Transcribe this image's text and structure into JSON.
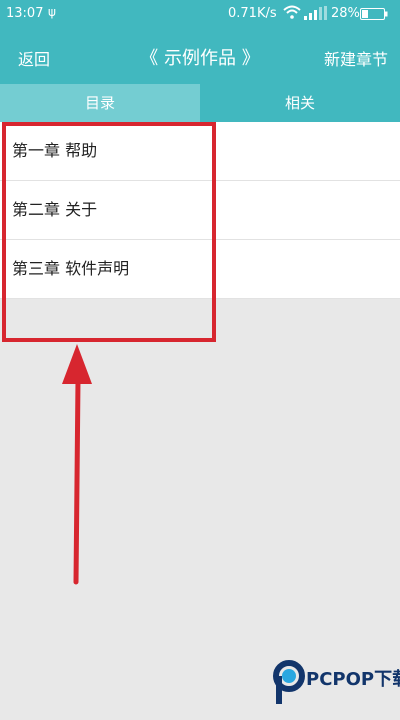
{
  "status_bar": {
    "time": "13:07",
    "speed": "0.71K/s",
    "battery": "28%"
  },
  "header": {
    "back_label": "返回",
    "title": "《 示例作品 》",
    "new_chapter_label": "新建章节"
  },
  "tabs": [
    {
      "label": "目录",
      "active": true
    },
    {
      "label": "相关",
      "active": false
    }
  ],
  "chapters": [
    {
      "label": "第一章 帮助"
    },
    {
      "label": "第二章 关于"
    },
    {
      "label": "第三章 软件声明"
    }
  ],
  "watermark": {
    "text": "PCPOP下载"
  },
  "colors": {
    "primary": "#41b8bf",
    "active_tab": "#74cdd2",
    "annotation": "#d7262f",
    "background": "#e8e8e8"
  }
}
